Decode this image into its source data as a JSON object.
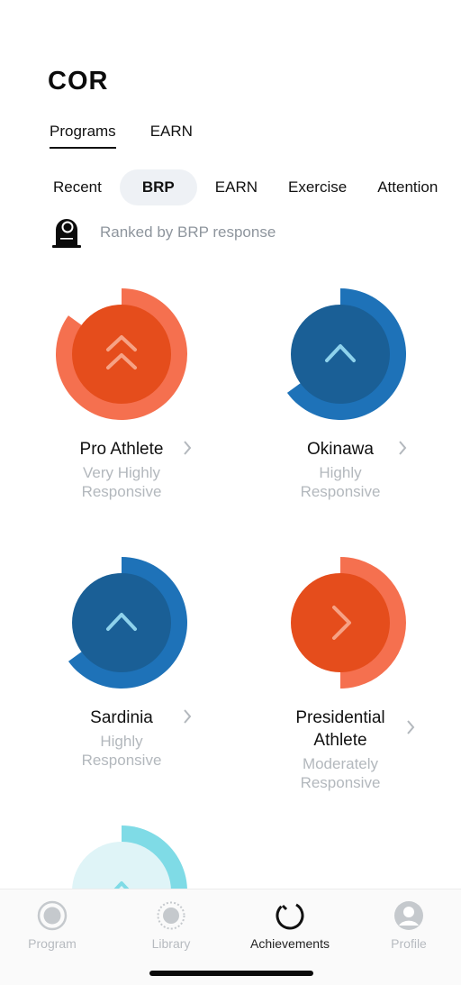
{
  "header": {
    "title": "COR"
  },
  "top_tabs": [
    {
      "label": "Programs",
      "active": true
    },
    {
      "label": "EARN",
      "active": false
    }
  ],
  "filter_chips": [
    {
      "label": "Recent",
      "active": false
    },
    {
      "label": "BRP",
      "active": true
    },
    {
      "label": "EARN",
      "active": false
    },
    {
      "label": "Exercise",
      "active": false
    },
    {
      "label": "Attention",
      "active": false
    }
  ],
  "rank": {
    "icon": "device-sensor-icon",
    "text": "Ranked by BRP response"
  },
  "programs": [
    {
      "title": "Pro Athlete",
      "subtitle_1": "Very Highly",
      "subtitle_2": "Responsive",
      "level_fraction": 0.85,
      "outer_color": "#f5704f",
      "inner_color": "#e54d1c",
      "arrow": "double-chevron-up-icon",
      "arrow_color": "#f6a285"
    },
    {
      "title": "Okinawa",
      "subtitle_1": "Highly",
      "subtitle_2": "Responsive",
      "level_fraction": 0.65,
      "outer_color": "#1e72b8",
      "inner_color": "#1a5f96",
      "arrow": "chevron-up-icon",
      "arrow_color": "#8ed2ec"
    },
    {
      "title": "Sardinia",
      "subtitle_1": "Highly",
      "subtitle_2": "Responsive",
      "level_fraction": 0.65,
      "outer_color": "#1e72b8",
      "inner_color": "#1a5f96",
      "arrow": "chevron-up-icon",
      "arrow_color": "#8ed2ec"
    },
    {
      "title_1": "Presidential",
      "title_2": "Athlete",
      "subtitle_1": "Moderately",
      "subtitle_2": "Responsive",
      "level_fraction": 0.5,
      "outer_color": "#f5704f",
      "inner_color": "#e54d1c",
      "arrow": "chevron-right-icon",
      "arrow_color": "#f6a285"
    },
    {
      "title": "",
      "level_fraction": 0.3,
      "outer_color": "#7fdbe6",
      "inner_color": "#dff4f7",
      "arrow": "chevron-up-icon",
      "arrow_color": "#7fdbe6"
    }
  ],
  "bottom_nav": [
    {
      "label": "Program",
      "icon": "record-circle-icon",
      "active": false
    },
    {
      "label": "Library",
      "icon": "dotted-circle-icon",
      "active": false
    },
    {
      "label": "Achievements",
      "icon": "progress-ring-icon",
      "active": true
    },
    {
      "label": "Profile",
      "icon": "user-avatar-icon",
      "active": false
    }
  ]
}
